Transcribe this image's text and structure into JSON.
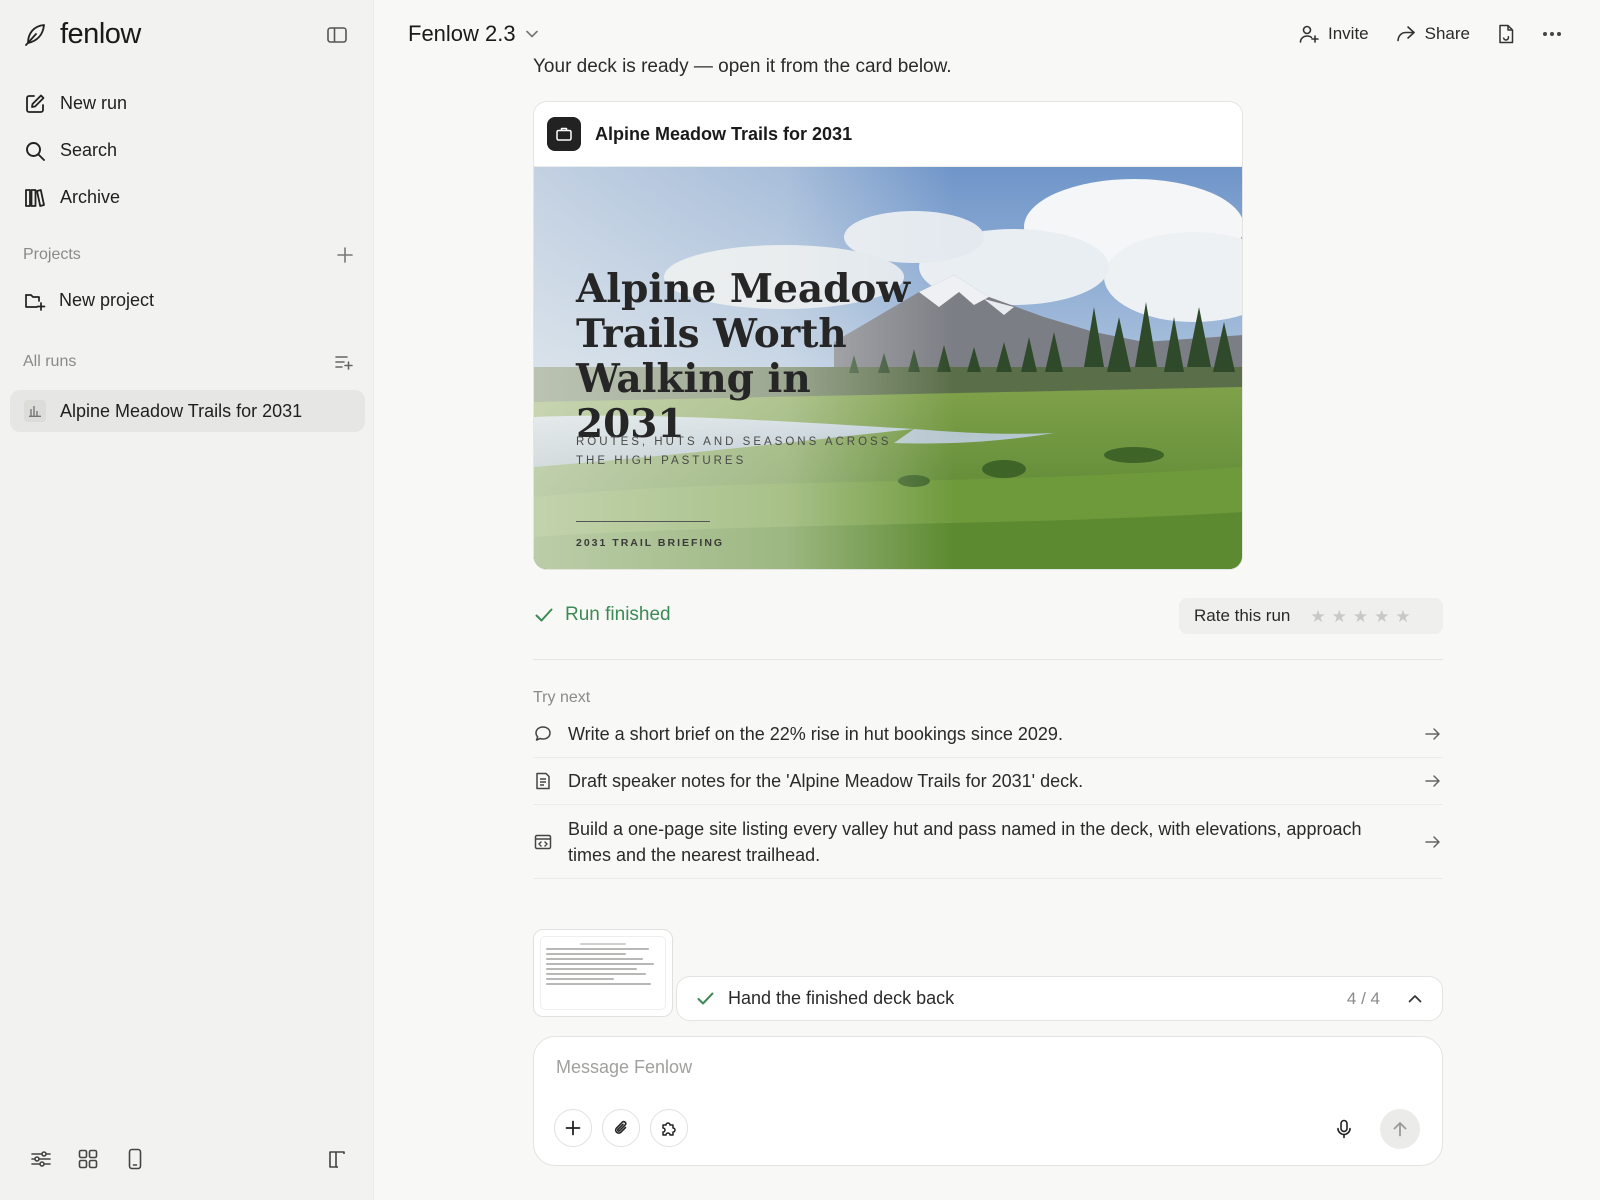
{
  "app": {
    "brand": "fenlow"
  },
  "sidebar": {
    "nav": [
      {
        "label": "New run",
        "icon": "compose-icon"
      },
      {
        "label": "Search",
        "icon": "search-icon"
      },
      {
        "label": "Archive",
        "icon": "books-icon"
      }
    ],
    "projects_label": "Projects",
    "new_project_label": "New project",
    "all_runs_label": "All runs",
    "runs": [
      {
        "label": "Alpine Meadow Trails for 2031",
        "selected": true
      }
    ]
  },
  "header": {
    "model": "Fenlow 2.3",
    "invite_label": "Invite",
    "share_label": "Share"
  },
  "main": {
    "intro": "Your deck is ready — open it from the card below.",
    "deck": {
      "title": "Alpine Meadow Trails for 2031",
      "slide_title": "Alpine Meadow Trails Worth Walking in 2031",
      "slide_subtitle": "ROUTES, HUTS AND SEASONS ACROSS THE HIGH PASTURES",
      "slide_footer": "2031 TRAIL BRIEFING"
    },
    "status": "Run finished",
    "rating": {
      "label": "Rate this run",
      "value": 0,
      "max": 5
    },
    "try_next_label": "Try next",
    "suggestions": [
      {
        "text": "Write a short brief on the 22% rise in hut bookings since 2029.",
        "icon": "chat-bubble-icon"
      },
      {
        "text": "Draft speaker notes for the 'Alpine Meadow Trails for 2031' deck.",
        "icon": "document-icon"
      },
      {
        "text": "Build a one-page site listing every valley hut and pass named in the deck, with elevations, approach times and the nearest trailhead.",
        "icon": "browser-window-icon"
      }
    ],
    "task": {
      "label": "Hand the finished deck back",
      "progress": "4 / 4"
    },
    "composer": {
      "placeholder": "Message Fenlow"
    }
  },
  "colors": {
    "accent_green": "#3c8a55",
    "sidebar_bg": "#f2f2f1",
    "selected_bg": "#e6e6e4"
  }
}
